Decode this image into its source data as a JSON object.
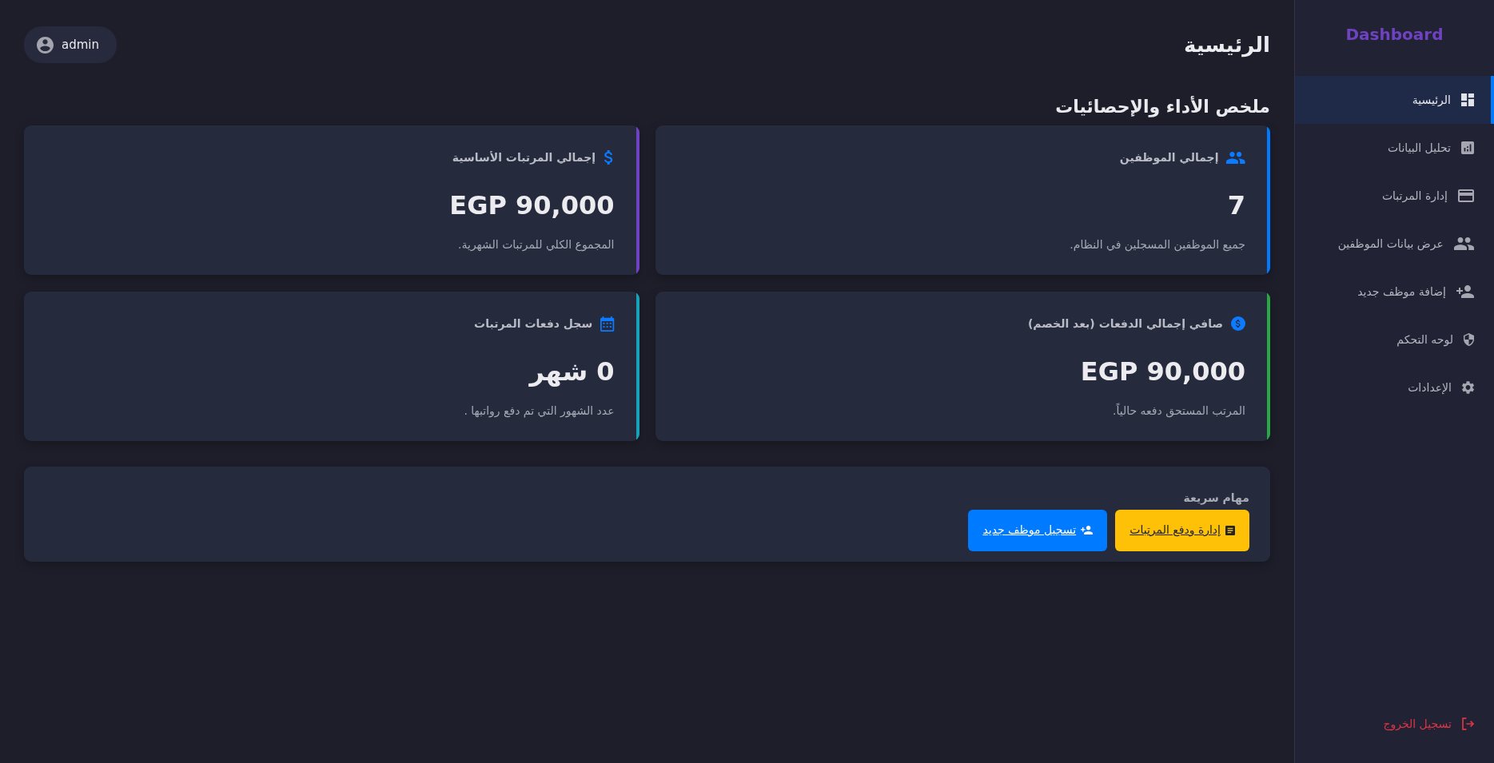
{
  "sidebar": {
    "brand": "Dashboard",
    "items": [
      {
        "label": "الرئيسية",
        "selected": true
      },
      {
        "label": "تحليل البيانات",
        "selected": false
      },
      {
        "label": "إدارة المرتبات",
        "selected": false
      },
      {
        "label": "عرض بيانات الموظفين",
        "selected": false
      },
      {
        "label": "إضافة موظف جديد",
        "selected": false
      },
      {
        "label": "لوحه التحكم",
        "selected": false
      },
      {
        "label": "الإعدادات",
        "selected": false
      }
    ],
    "logout": "تسجيل الخروج"
  },
  "header": {
    "title": "الرئيسية",
    "user": "admin"
  },
  "summary": {
    "title": "ملخص الأداء والإحصائيات",
    "stat_cards": [
      {
        "title": "إجمالي الموظفين",
        "value": "7",
        "description": "جميع الموظفين المسجلين في النظام.",
        "color": "#007bff"
      },
      {
        "title": "إجمالي المرتبات الأساسية",
        "value": "EGP 90,000",
        "description": "المجموع الكلي للمرتبات الشهرية.",
        "color": "#6f42c1"
      },
      {
        "title": "صافي إجمالي الدفعات (بعد الخصم)",
        "value": "EGP 90,000",
        "description": "المرتب المستحق دفعه حالياً.",
        "color": "#28a745"
      },
      {
        "title": "سجل دفعات المرتبات",
        "value": "0 شهر",
        "description": "عدد الشهور التي تم دفع رواتبها .",
        "color": "#17a2b8"
      }
    ]
  },
  "quick_tasks": {
    "title": "مهام سريعة",
    "buttons": [
      {
        "label": "إدارة ودفع المرتبات",
        "color": "#ffc107"
      },
      {
        "label": "تسجيل موظف جديد",
        "color": "#007bff"
      }
    ]
  }
}
